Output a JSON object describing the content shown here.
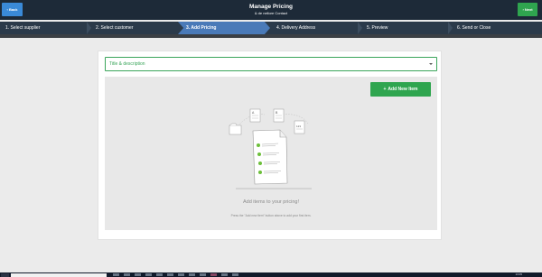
{
  "header": {
    "back_label": "Back",
    "next_label": "Next",
    "title": "Manage Pricing",
    "subtitle": "& de nellore Contact"
  },
  "steps": [
    {
      "label": "1. Select supplier"
    },
    {
      "label": "2. Select customer"
    },
    {
      "label": "3. Add Pricing"
    },
    {
      "label": "4. Delivery Address"
    },
    {
      "label": "5. Preview"
    },
    {
      "label": "6. Send or Close"
    }
  ],
  "active_step": 3,
  "form": {
    "dropdown_value": "Title & description"
  },
  "panel": {
    "add_button_label": "Add New Item",
    "empty_title": "Add items to your pricing!",
    "empty_hint": "Press the \"Add new item\" button above to add your first item."
  },
  "taskbar": {
    "clock": "13:05"
  },
  "colors": {
    "topbar": "#1d2a38",
    "back_button": "#3a8ad8",
    "next_button": "#2fa54f",
    "active_step": "#4a7ab8",
    "accent_green": "#3aa55a"
  }
}
